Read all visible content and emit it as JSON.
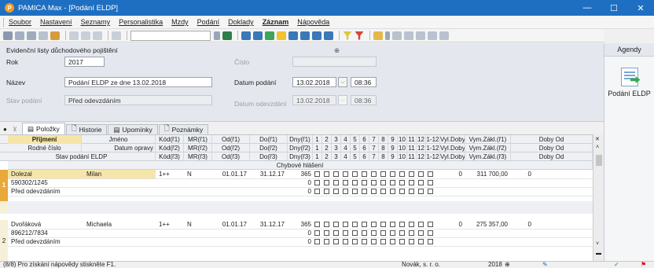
{
  "window": {
    "title": "PAMICA Max - [Podání ELDP]",
    "app_icon_letter": "P"
  },
  "menu": [
    "Soubor",
    "Nastavení",
    "Seznamy",
    "Personalistika",
    "Mzdy",
    "Podání",
    "Doklady",
    "Záznam",
    "Nápověda"
  ],
  "form": {
    "section_title": "Evidenční listy důchodového pojištění",
    "rok_label": "Rok",
    "rok_value": "2017",
    "cislo_label": "Číslo",
    "cislo_value": "",
    "nazev_label": "Název",
    "nazev_value": "Podání ELDP ze dne 13.02.2018",
    "datum_podani_label": "Datum podání",
    "datum_podani_value": "13.02.2018",
    "datum_podani_time": "08:36",
    "stav_label": "Stav podání",
    "stav_value": "Před odevzdáním",
    "datum_odevzdani_label": "Datum odevzdání",
    "datum_odevzdani_value": "13.02.2018",
    "datum_odevzdani_time": "08:36",
    "marker_symbol": "⊕"
  },
  "agendy": {
    "title": "Agendy",
    "item": "Podání ELDP"
  },
  "tabs": [
    "Položky",
    "Historie",
    "Upomínky",
    "Poznámky"
  ],
  "header_rows": [
    [
      "Příjmení",
      "Jméno",
      "Kód(ř1)",
      "MR(ř1)",
      "Od(ř1)",
      "Do(ř1)",
      "Dny(ř1)",
      "1",
      "2",
      "3",
      "4",
      "5",
      "6",
      "7",
      "8",
      "9",
      "10",
      "11",
      "12",
      "1-12",
      "Vyl.Doby",
      "Vym.Zákl.(ř1)",
      "Doby Od"
    ],
    [
      "Rodné číslo",
      "Datum opravy",
      "Kód(ř2)",
      "MR(ř2)",
      "Od(ř2)",
      "Do(ř2)",
      "Dny(ř2)",
      "1",
      "2",
      "3",
      "4",
      "5",
      "6",
      "7",
      "8",
      "9",
      "10",
      "11",
      "12",
      "1-12",
      "Vyl.Doby",
      "Vym.Zákl.(ř2)",
      "Doby Od"
    ],
    [
      "Stav podání ELDP",
      "",
      "Kód(ř3)",
      "MR(ř3)",
      "Od(ř3)",
      "Do(ř3)",
      "Dny(ř3)",
      "1",
      "2",
      "3",
      "4",
      "5",
      "6",
      "7",
      "8",
      "9",
      "10",
      "11",
      "12",
      "1-12",
      "Vyl.Doby",
      "Vym.Zákl.(ř3)",
      "Doby Od"
    ]
  ],
  "chybove_label": "Chybové hlášení",
  "records": [
    {
      "num": "1",
      "prijmeni": "Dolezal",
      "jmeno": "Milan",
      "rc": "590302/1245",
      "stav": "Před odevzdáním",
      "kod": "1++",
      "mr": "N",
      "od": "01.01.17",
      "do": "31.12.17",
      "dny": [
        "365",
        "0",
        "0"
      ],
      "vyl": "0",
      "vym": "311 700,00",
      "doby": "0"
    },
    {
      "num": "2",
      "prijmeni": "Dvořáková",
      "jmeno": "Michaela",
      "rc": "896212/7834",
      "stav": "Před odevzdáním",
      "kod": "1++",
      "mr": "N",
      "od": "01.01.17",
      "do": "31.12.17",
      "dny": [
        "365",
        "0",
        "0"
      ],
      "vyl": "0",
      "vym": "275 357,00",
      "doby": "0"
    }
  ],
  "status": {
    "help": "(8/8) Pro získání nápovědy stiskněte F1.",
    "company": "Novák, s. r. o.",
    "year": "2018"
  }
}
